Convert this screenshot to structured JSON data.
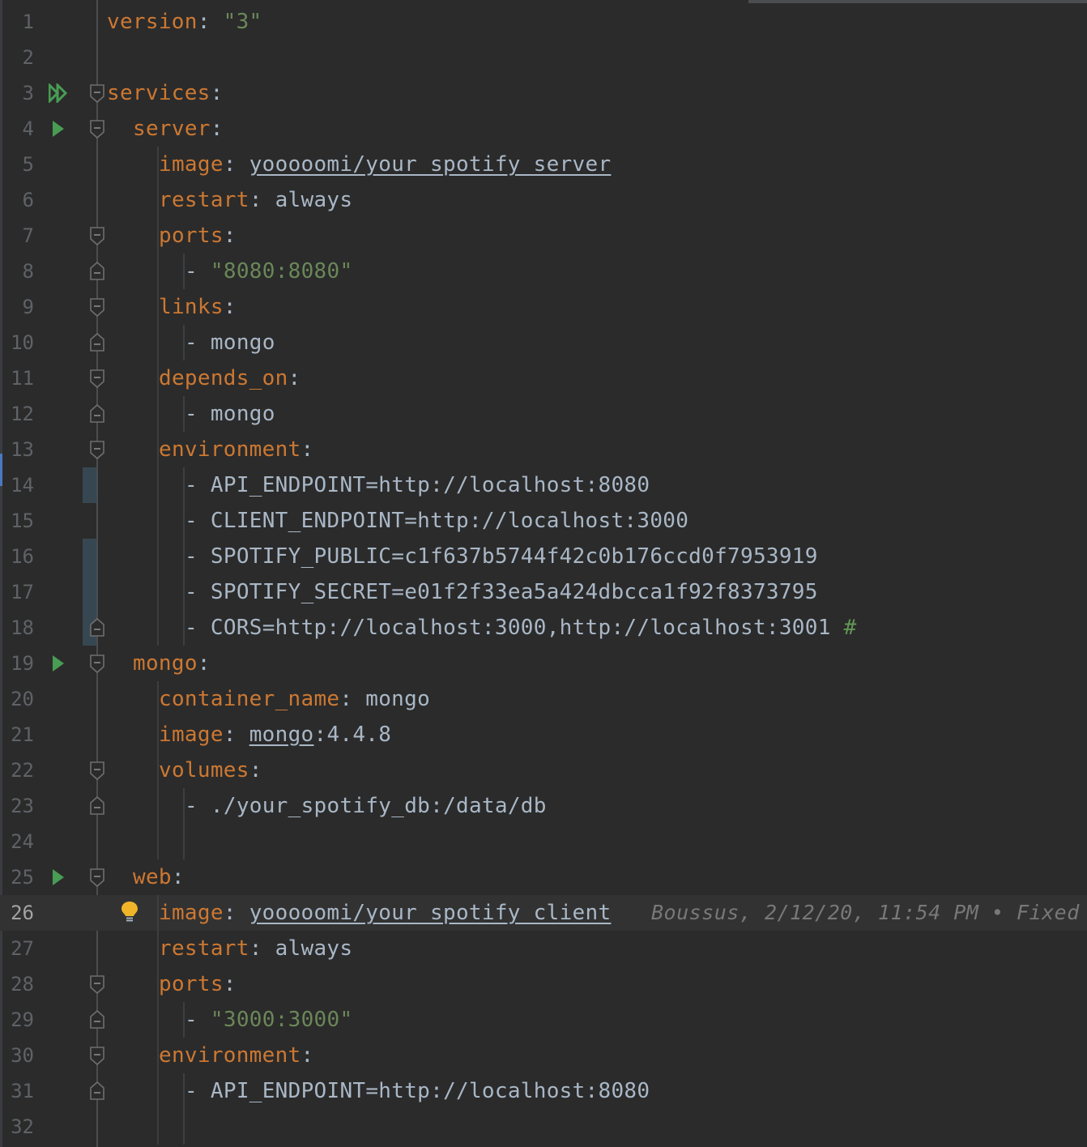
{
  "editor": {
    "file_content": "docker-compose yaml",
    "blame_annotation": "Boussus, 2/12/20, 11:54 PM • Fixed",
    "lines": [
      {
        "n": "1",
        "indent": 0,
        "segs": [
          [
            "key",
            "version"
          ],
          [
            "plain",
            ": "
          ],
          [
            "str",
            "\"3\""
          ]
        ]
      },
      {
        "n": "2",
        "indent": 0,
        "segs": []
      },
      {
        "n": "3",
        "indent": 0,
        "run": "run-all",
        "fold": "open",
        "segs": [
          [
            "key",
            "services"
          ],
          [
            "plain",
            ":"
          ]
        ]
      },
      {
        "n": "4",
        "indent": 1,
        "run": "run",
        "fold": "open",
        "segs": [
          [
            "key",
            "server"
          ],
          [
            "plain",
            ":"
          ]
        ]
      },
      {
        "n": "5",
        "indent": 2,
        "segs": [
          [
            "key",
            "image"
          ],
          [
            "plain",
            ": "
          ],
          [
            "plain-ul",
            "yooooomi/your_spotify_server"
          ]
        ]
      },
      {
        "n": "6",
        "indent": 2,
        "segs": [
          [
            "key",
            "restart"
          ],
          [
            "plain",
            ": always"
          ]
        ]
      },
      {
        "n": "7",
        "indent": 2,
        "fold": "open",
        "segs": [
          [
            "key",
            "ports"
          ],
          [
            "plain",
            ":"
          ]
        ]
      },
      {
        "n": "8",
        "indent": 3,
        "fold": "end",
        "segs": [
          [
            "plain",
            "- "
          ],
          [
            "str",
            "\"8080:8080\""
          ]
        ]
      },
      {
        "n": "9",
        "indent": 2,
        "fold": "open",
        "segs": [
          [
            "key",
            "links"
          ],
          [
            "plain",
            ":"
          ]
        ]
      },
      {
        "n": "10",
        "indent": 3,
        "fold": "end",
        "segs": [
          [
            "plain",
            "- mongo"
          ]
        ]
      },
      {
        "n": "11",
        "indent": 2,
        "fold": "open",
        "segs": [
          [
            "key",
            "depends_on"
          ],
          [
            "plain",
            ":"
          ]
        ]
      },
      {
        "n": "12",
        "indent": 3,
        "fold": "end",
        "segs": [
          [
            "plain",
            "- mongo"
          ]
        ]
      },
      {
        "n": "13",
        "indent": 2,
        "fold": "open",
        "segs": [
          [
            "key",
            "environment"
          ],
          [
            "plain",
            ":"
          ]
        ]
      },
      {
        "n": "14",
        "indent": 3,
        "change": true,
        "segs": [
          [
            "plain",
            "- API_ENDPOINT=http://localhost:8080"
          ]
        ]
      },
      {
        "n": "15",
        "indent": 3,
        "segs": [
          [
            "plain",
            "- CLIENT_ENDPOINT=http://localhost:3000"
          ]
        ]
      },
      {
        "n": "16",
        "indent": 3,
        "change": true,
        "segs": [
          [
            "plain",
            "- SPOTIFY_PUBLIC=c1f637b5744f42c0b176ccd0f7953919"
          ]
        ]
      },
      {
        "n": "17",
        "indent": 3,
        "change": true,
        "segs": [
          [
            "plain",
            "- SPOTIFY_SECRET=e01f2f33ea5a424dbcca1f92f8373795"
          ]
        ]
      },
      {
        "n": "18",
        "indent": 3,
        "change": true,
        "fold": "end",
        "segs": [
          [
            "plain",
            "- CORS=http://localhost:3000,http://localhost:3001 "
          ],
          [
            "cmt",
            "#"
          ]
        ]
      },
      {
        "n": "19",
        "indent": 1,
        "run": "run",
        "fold": "open",
        "segs": [
          [
            "key",
            "mongo"
          ],
          [
            "plain",
            ":"
          ]
        ]
      },
      {
        "n": "20",
        "indent": 2,
        "segs": [
          [
            "key",
            "container_name"
          ],
          [
            "plain",
            ": mongo"
          ]
        ]
      },
      {
        "n": "21",
        "indent": 2,
        "segs": [
          [
            "key",
            "image"
          ],
          [
            "plain",
            ": "
          ],
          [
            "plain-ul",
            "mongo"
          ],
          [
            "plain",
            ":4.4.8"
          ]
        ]
      },
      {
        "n": "22",
        "indent": 2,
        "fold": "open",
        "segs": [
          [
            "key",
            "volumes"
          ],
          [
            "plain",
            ":"
          ]
        ]
      },
      {
        "n": "23",
        "indent": 3,
        "fold": "end",
        "segs": [
          [
            "plain",
            "- ./your_spotify_db:/data/db"
          ]
        ]
      },
      {
        "n": "24",
        "indent": 0,
        "segs": []
      },
      {
        "n": "25",
        "indent": 1,
        "run": "run",
        "fold": "open",
        "segs": [
          [
            "key",
            "web"
          ],
          [
            "plain",
            ":"
          ]
        ]
      },
      {
        "n": "26",
        "indent": 2,
        "current": true,
        "bulb": true,
        "segs": [
          [
            "key",
            "image"
          ],
          [
            "plain",
            ": "
          ],
          [
            "plain-ul",
            "yooooomi/your_spotify_client"
          ]
        ]
      },
      {
        "n": "27",
        "indent": 2,
        "segs": [
          [
            "key",
            "restart"
          ],
          [
            "plain",
            ": always"
          ]
        ]
      },
      {
        "n": "28",
        "indent": 2,
        "fold": "open",
        "segs": [
          [
            "key",
            "ports"
          ],
          [
            "plain",
            ":"
          ]
        ]
      },
      {
        "n": "29",
        "indent": 3,
        "fold": "end",
        "segs": [
          [
            "plain",
            "- "
          ],
          [
            "str",
            "\"3000:3000\""
          ]
        ]
      },
      {
        "n": "30",
        "indent": 2,
        "fold": "open",
        "segs": [
          [
            "key",
            "environment"
          ],
          [
            "plain",
            ":"
          ]
        ]
      },
      {
        "n": "31",
        "indent": 3,
        "fold": "end",
        "segs": [
          [
            "plain",
            "- API_ENDPOINT=http://localhost:8080"
          ]
        ]
      },
      {
        "n": "32",
        "indent": 0,
        "segs": []
      }
    ]
  },
  "colors": {
    "background": "#2b2b2b",
    "key": "#cc7832",
    "string": "#6a8759",
    "text": "#a9b7c6",
    "line_number": "#5f6266",
    "run_icon": "#499c54",
    "bulb": "#f0b429"
  },
  "icons": {
    "run_all": "run-all-icon",
    "run": "run-icon",
    "fold_open": "fold-open-icon",
    "fold_end": "fold-end-icon",
    "intention": "intention-bulb-icon"
  }
}
